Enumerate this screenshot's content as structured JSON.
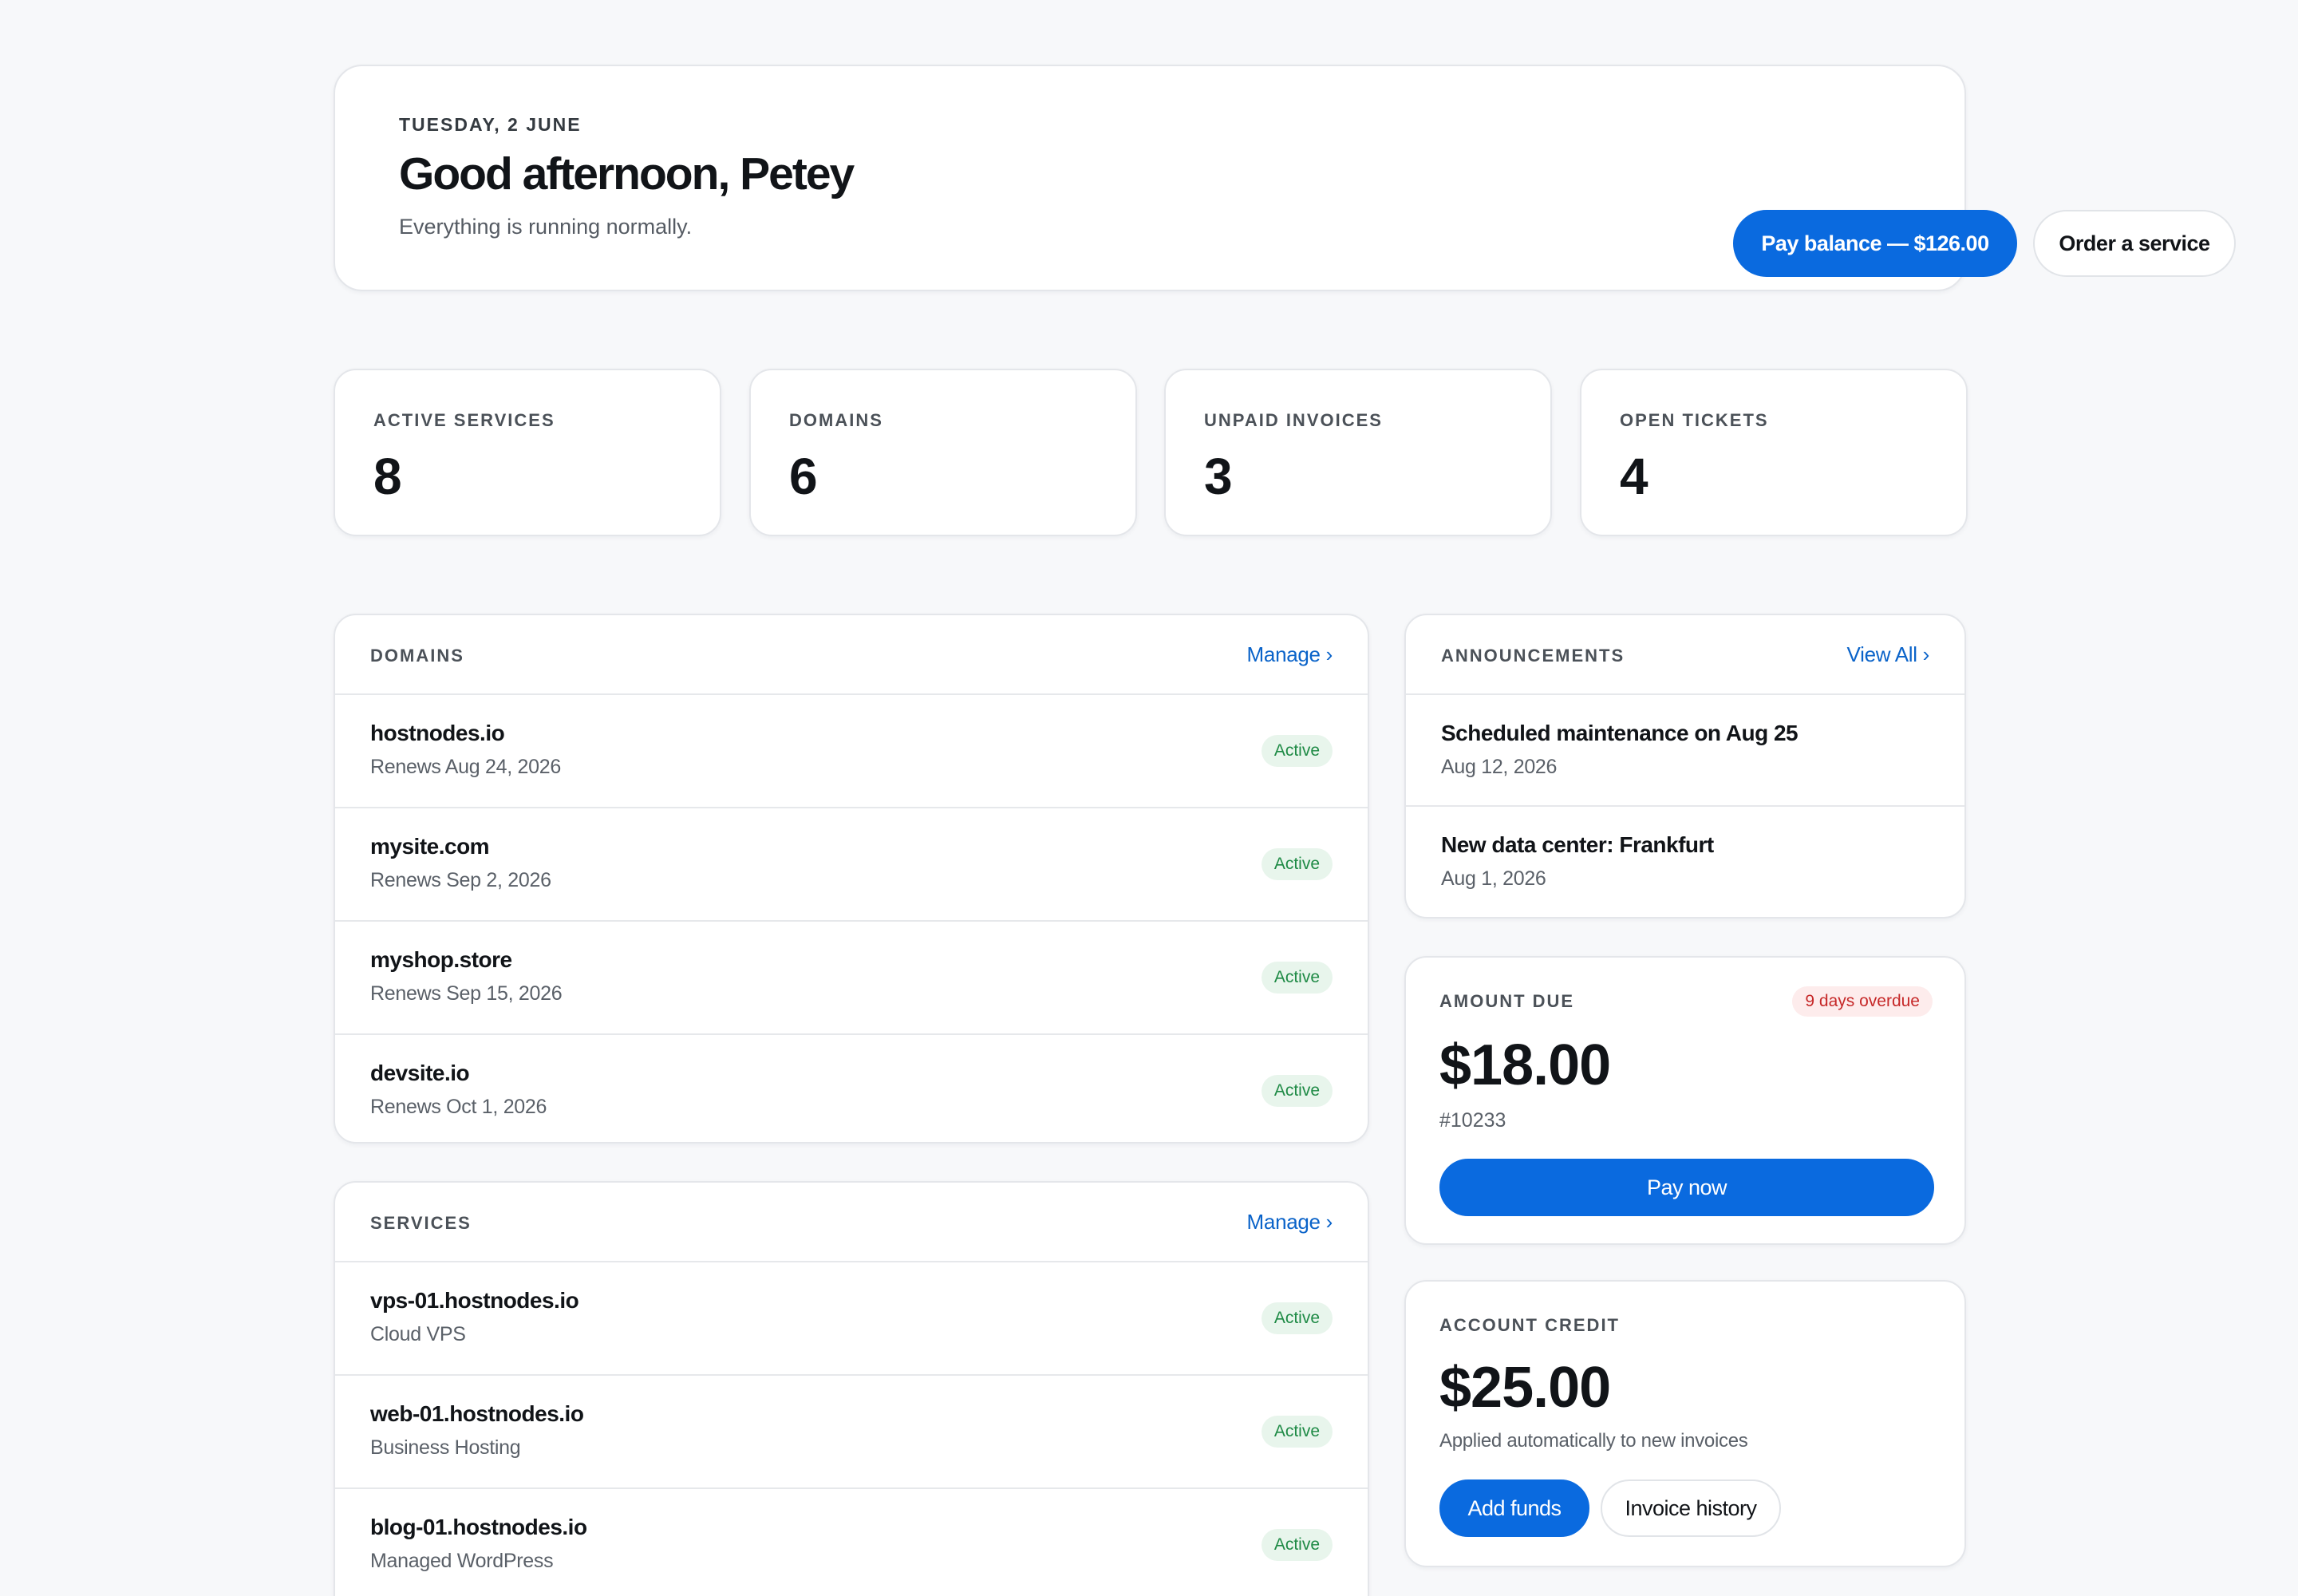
{
  "hero": {
    "date": "TUESDAY, 2 JUNE",
    "greeting": "Good afternoon, Petey",
    "status": "Everything is running normally.",
    "pay_balance_label": "Pay balance — $126.00",
    "order_service_label": "Order a service"
  },
  "stats": [
    {
      "label": "ACTIVE SERVICES",
      "value": "8"
    },
    {
      "label": "DOMAINS",
      "value": "6"
    },
    {
      "label": "UNPAID INVOICES",
      "value": "3"
    },
    {
      "label": "OPEN TICKETS",
      "value": "4"
    }
  ],
  "domains": {
    "title": "DOMAINS",
    "link": "Manage ›",
    "items": [
      {
        "name": "hostnodes.io",
        "meta": "Renews Aug 24, 2026",
        "status": "Active"
      },
      {
        "name": "mysite.com",
        "meta": "Renews Sep 2, 2026",
        "status": "Active"
      },
      {
        "name": "myshop.store",
        "meta": "Renews Sep 15, 2026",
        "status": "Active"
      },
      {
        "name": "devsite.io",
        "meta": "Renews Oct 1, 2026",
        "status": "Active"
      }
    ]
  },
  "services": {
    "title": "SERVICES",
    "link": "Manage ›",
    "items": [
      {
        "name": "vps-01.hostnodes.io",
        "meta": "Cloud VPS",
        "status": "Active"
      },
      {
        "name": "web-01.hostnodes.io",
        "meta": "Business Hosting",
        "status": "Active"
      },
      {
        "name": "blog-01.hostnodes.io",
        "meta": "Managed WordPress",
        "status": "Active"
      }
    ]
  },
  "announcements": {
    "title": "ANNOUNCEMENTS",
    "link": "View All ›",
    "items": [
      {
        "title": "Scheduled maintenance on Aug 25",
        "date": "Aug 12, 2026"
      },
      {
        "title": "New data center: Frankfurt",
        "date": "Aug 1, 2026"
      }
    ]
  },
  "amount_due": {
    "label": "AMOUNT DUE",
    "overdue": "9 days overdue",
    "amount": "$18.00",
    "invoice": "#10233",
    "pay_label": "Pay now"
  },
  "credit": {
    "label": "ACCOUNT CREDIT",
    "amount": "$25.00",
    "note": "Applied automatically to new invoices",
    "add_funds_label": "Add funds",
    "history_label": "Invoice history"
  },
  "colors": {
    "accent": "#0a6adf",
    "active_badge_bg": "#e8f5ec",
    "active_badge_text": "#1e8a45",
    "overdue_bg": "#fdecec",
    "overdue_text": "#c62828",
    "page_bg": "#f7f8fa"
  }
}
